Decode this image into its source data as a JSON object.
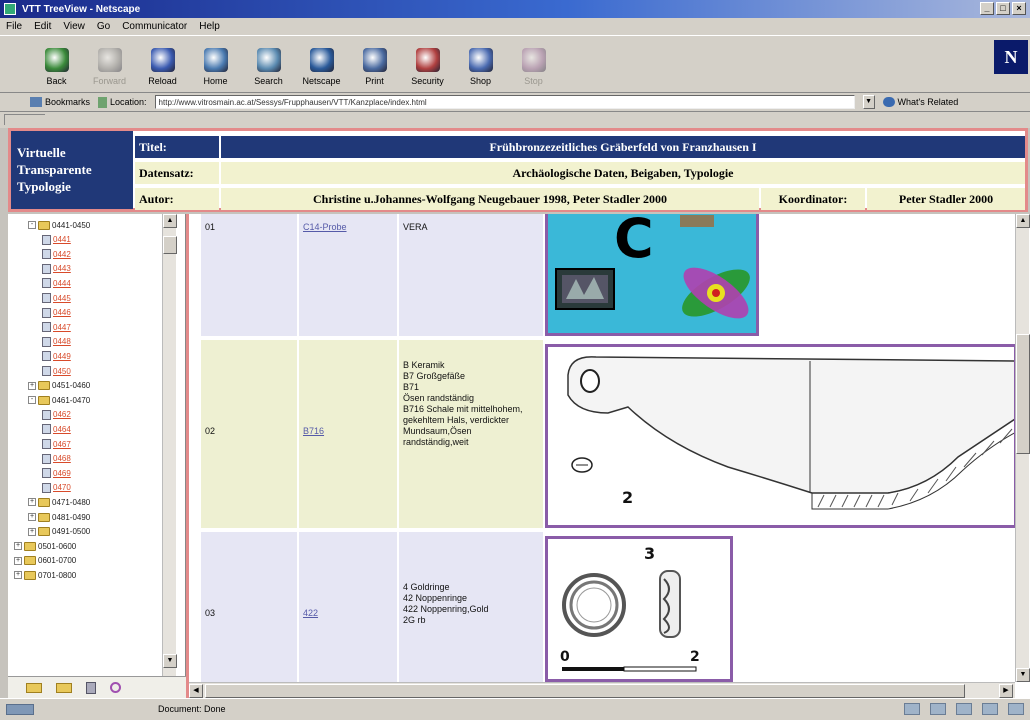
{
  "window": {
    "title": "VTT TreeView - Netscape",
    "buttons": [
      "_",
      "□",
      "×"
    ]
  },
  "menu": [
    "File",
    "Edit",
    "View",
    "Go",
    "Communicator",
    "Help"
  ],
  "toolbar": [
    {
      "label": "Back",
      "icon": "back-arrow-icon",
      "enabled": true
    },
    {
      "label": "Forward",
      "icon": "forward-arrow-icon",
      "enabled": false
    },
    {
      "label": "Reload",
      "icon": "reload-icon",
      "enabled": true
    },
    {
      "label": "Home",
      "icon": "home-icon",
      "enabled": true
    },
    {
      "label": "Search",
      "icon": "search-icon",
      "enabled": true
    },
    {
      "label": "Netscape",
      "icon": "netscape-icon",
      "enabled": true
    },
    {
      "label": "Print",
      "icon": "print-icon",
      "enabled": true
    },
    {
      "label": "Security",
      "icon": "security-lock-icon",
      "enabled": true
    },
    {
      "label": "Shop",
      "icon": "shop-bag-icon",
      "enabled": true
    },
    {
      "label": "Stop",
      "icon": "stop-icon",
      "enabled": false
    }
  ],
  "location": {
    "bookmarks_label": "Bookmarks",
    "location_label": "Location:",
    "url": "http://www.vitrosmain.ac.at/Sessys/Frupphausen/VTT/Kanzplace/index.html",
    "related_label": "What's Related"
  },
  "header": {
    "brand": [
      "Virtuelle",
      "Transparente",
      "Typologie"
    ],
    "titel_label": "Titel:",
    "titel_value": "Frühbronzezeitliches Gräberfeld von Franzhausen I",
    "datensatz_label": "Datensatz:",
    "datensatz_value": "Archäologische Daten, Beigaben, Typologie",
    "autor_label": "Autor:",
    "autor_value": "Christine u.Johannes-Wolfgang Neugebauer 1998, Peter Stadler 2000",
    "koordinator_label": "Koordinator:",
    "koordinator_value": "Peter Stadler 2000"
  },
  "tree": {
    "items": [
      {
        "label": "0441-0450",
        "kind": "folder",
        "level": 1,
        "state": "-"
      },
      {
        "label": "0441",
        "kind": "doc",
        "level": 2
      },
      {
        "label": "0442",
        "kind": "doc",
        "level": 2
      },
      {
        "label": "0443",
        "kind": "doc",
        "level": 2
      },
      {
        "label": "0444",
        "kind": "doc",
        "level": 2
      },
      {
        "label": "0445",
        "kind": "doc",
        "level": 2
      },
      {
        "label": "0446",
        "kind": "doc",
        "level": 2
      },
      {
        "label": "0447",
        "kind": "doc",
        "level": 2
      },
      {
        "label": "0448",
        "kind": "doc",
        "level": 2
      },
      {
        "label": "0449",
        "kind": "doc",
        "level": 2
      },
      {
        "label": "0450",
        "kind": "doc",
        "level": 2
      },
      {
        "label": "0451-0460",
        "kind": "folder",
        "level": 1,
        "state": "+"
      },
      {
        "label": "0461-0470",
        "kind": "folder",
        "level": 1,
        "state": "-"
      },
      {
        "label": "0462",
        "kind": "doc",
        "level": 2
      },
      {
        "label": "0464",
        "kind": "doc",
        "level": 2
      },
      {
        "label": "0467",
        "kind": "doc",
        "level": 2
      },
      {
        "label": "0468",
        "kind": "doc",
        "level": 2
      },
      {
        "label": "0469",
        "kind": "doc",
        "level": 2
      },
      {
        "label": "0470",
        "kind": "doc",
        "level": 2
      },
      {
        "label": "0471-0480",
        "kind": "folder",
        "level": 1,
        "state": "+"
      },
      {
        "label": "0481-0490",
        "kind": "folder",
        "level": 1,
        "state": "+"
      },
      {
        "label": "0491-0500",
        "kind": "folder",
        "level": 1,
        "state": "+"
      },
      {
        "label": "0501-0600",
        "kind": "folder",
        "level": 0,
        "state": "+"
      },
      {
        "label": "0601-0700",
        "kind": "folder",
        "level": 0,
        "state": "+"
      },
      {
        "label": "0701-0800",
        "kind": "folder",
        "level": 0,
        "state": "+"
      }
    ],
    "bottom_icons": [
      "expand-folder-icon",
      "collapse-folder-icon",
      "document-icon",
      "settings-icon"
    ]
  },
  "rows": [
    {
      "num": "01",
      "link": "C14-Probe",
      "desc": "VERA",
      "figure_label": "C"
    },
    {
      "num": "02",
      "link": "B716",
      "desc": "B Keramik\nB7 Großgefäße\nB71\nÖsen randständig\nB716 Schale mit mittelhohem, gekehltem Hals, verdickter Mundsaum,Ösen randständig,weit",
      "figure_label": "2"
    },
    {
      "num": "03",
      "link": "422",
      "desc": "4 Goldringe\n42 Noppenringe\n422 Noppenring,Gold\n2G rb",
      "figure_label": "3",
      "scale_start": "0",
      "scale_end": "2"
    }
  ],
  "status": {
    "text": "Document: Done"
  }
}
